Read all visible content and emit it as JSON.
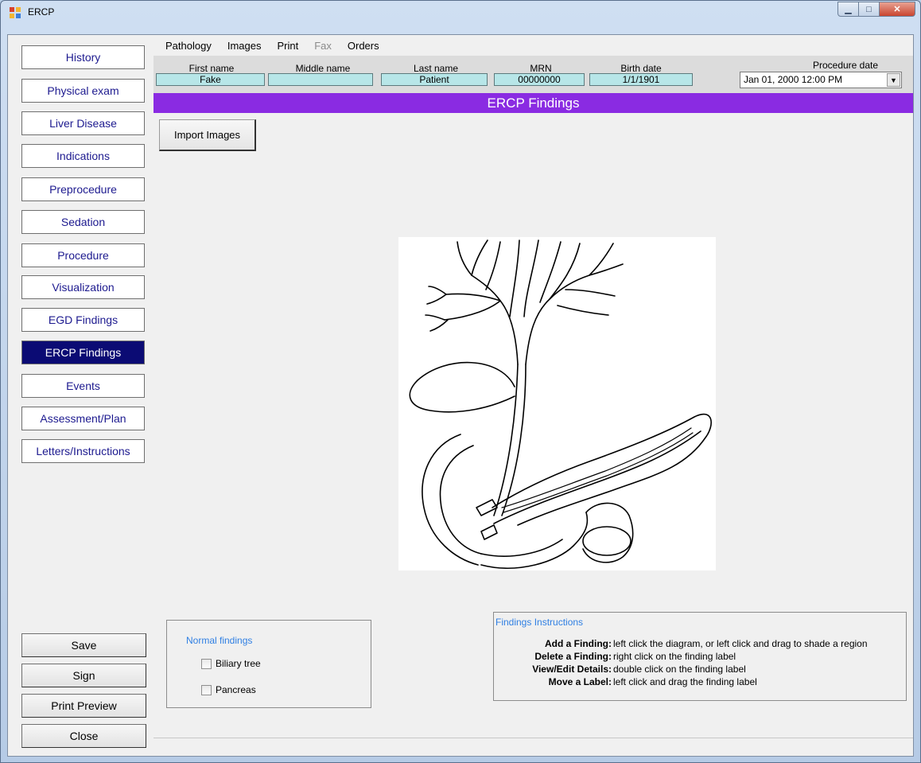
{
  "window": {
    "title": "ERCP"
  },
  "nav": {
    "items": [
      {
        "label": "History",
        "active": false
      },
      {
        "label": "Physical exam",
        "active": false
      },
      {
        "label": "Liver Disease",
        "active": false
      },
      {
        "label": "Indications",
        "active": false
      },
      {
        "label": "Preprocedure",
        "active": false
      },
      {
        "label": "Sedation",
        "active": false
      },
      {
        "label": "Procedure",
        "active": false
      },
      {
        "label": "Visualization",
        "active": false
      },
      {
        "label": "EGD Findings",
        "active": false
      },
      {
        "label": "ERCP Findings",
        "active": true
      },
      {
        "label": "Events",
        "active": false
      },
      {
        "label": "Assessment/Plan",
        "active": false
      },
      {
        "label": "Letters/Instructions",
        "active": false
      }
    ],
    "actions": [
      "Save",
      "Sign",
      "Print Preview",
      "Close"
    ]
  },
  "menu": {
    "items": [
      {
        "label": "Pathology",
        "enabled": true
      },
      {
        "label": "Images",
        "enabled": true
      },
      {
        "label": "Print",
        "enabled": true
      },
      {
        "label": "Fax",
        "enabled": false
      },
      {
        "label": "Orders",
        "enabled": true
      }
    ]
  },
  "patient": {
    "first_name_label": "First name",
    "first_name": "Fake",
    "middle_name_label": "Middle name",
    "middle_name": "",
    "last_name_label": "Last name",
    "last_name": "Patient",
    "mrn_label": "MRN",
    "mrn": "00000000",
    "birth_date_label": "Birth date",
    "birth_date": "1/1/1901",
    "procedure_date_label": "Procedure date",
    "procedure_date": "Jan  01, 2000 12:00 PM"
  },
  "banner": {
    "title": "ERCP Findings"
  },
  "toolbar": {
    "import_images": "Import Images"
  },
  "normal_findings": {
    "title": "Normal findings",
    "items": [
      {
        "label": "Biliary tree",
        "checked": false
      },
      {
        "label": "Pancreas",
        "checked": false
      }
    ]
  },
  "instructions": {
    "title": "Findings Instructions",
    "rows": [
      {
        "key": "Add a Finding:",
        "text": "left click the diagram, or left click and drag to shade a region"
      },
      {
        "key": "Delete a Finding:",
        "text": "right click on the finding label"
      },
      {
        "key": "View/Edit Details:",
        "text": "double click on the finding label"
      },
      {
        "key": "Move a Label:",
        "text": "left click and drag the finding label"
      }
    ]
  },
  "colors": {
    "banner": "#8a2be2",
    "nav_active": "#0b0b74",
    "nav_text": "#1d1a8f",
    "field_bg": "#b7e6e8",
    "group_title": "#2f7fe3"
  }
}
